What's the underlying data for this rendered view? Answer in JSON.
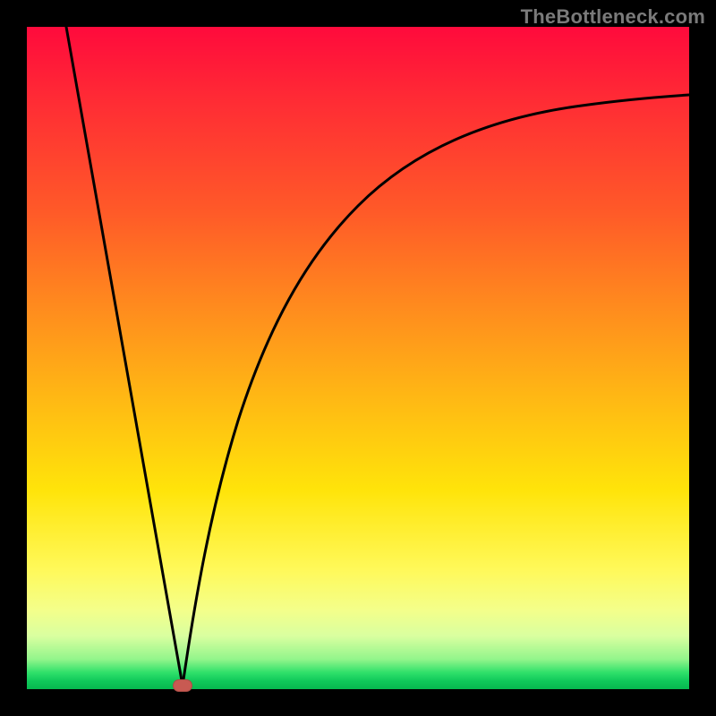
{
  "watermark": "TheBottleneck.com",
  "colors": {
    "page_bg": "#000000",
    "curve": "#000000",
    "marker": "#c85a52",
    "watermark": "#7a7a7a",
    "gradient_top": "#ff0a3c",
    "gradient_bottom": "#07b84f"
  },
  "chart_data": {
    "type": "line",
    "title": "",
    "xlabel": "",
    "ylabel": "",
    "xlim": [
      0,
      100
    ],
    "ylim": [
      0,
      100
    ],
    "grid": false,
    "legend": false,
    "annotations": [
      {
        "text": "TheBottleneck.com",
        "position": "top-right"
      }
    ],
    "series": [
      {
        "name": "left-branch",
        "x": [
          6,
          8,
          10,
          12,
          14,
          16,
          18,
          20,
          22,
          23.5
        ],
        "values": [
          100,
          88,
          76,
          64,
          52,
          40,
          28,
          16,
          6,
          0.5
        ]
      },
      {
        "name": "right-branch",
        "x": [
          23.5,
          25,
          27,
          30,
          34,
          38,
          43,
          48,
          54,
          60,
          67,
          74,
          82,
          90,
          100
        ],
        "values": [
          0.5,
          7,
          16,
          27,
          38,
          47,
          55,
          62,
          68,
          73,
          77.5,
          81,
          84,
          86.5,
          89
        ]
      }
    ],
    "marker": {
      "x": 23.5,
      "y": 0.5
    }
  }
}
